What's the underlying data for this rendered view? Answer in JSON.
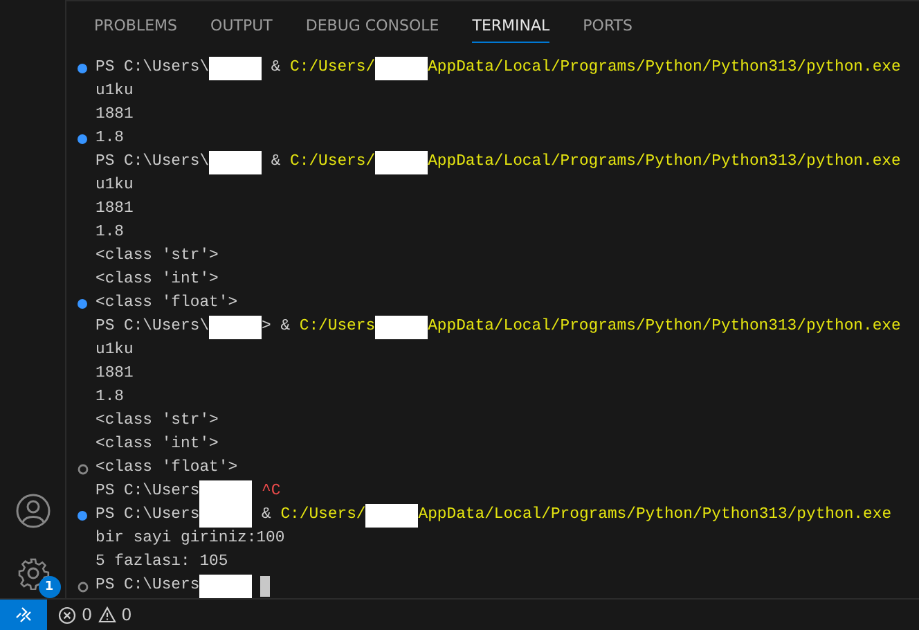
{
  "tabs": [
    {
      "label": "PROBLEMS",
      "selected": false
    },
    {
      "label": "OUTPUT",
      "selected": false
    },
    {
      "label": "DEBUG CONSOLE",
      "selected": false
    },
    {
      "label": "TERMINAL",
      "selected": true
    },
    {
      "label": "PORTS",
      "selected": false
    }
  ],
  "terminal": {
    "lines": [
      {
        "marker": true,
        "success": true,
        "segments": [
          {
            "kind": "text",
            "text": "PS C:\\Users\\"
          },
          {
            "kind": "redacted"
          },
          {
            "kind": "text",
            "text": " & "
          },
          {
            "kind": "path",
            "text": "C:/Users/"
          },
          {
            "kind": "redacted"
          },
          {
            "kind": "path",
            "text": "AppData/Local/Programs/Python/Python313/python.exe"
          }
        ]
      },
      {
        "marker": false,
        "segments": [
          {
            "kind": "text",
            "text": "u1ku"
          }
        ]
      },
      {
        "marker": false,
        "segments": [
          {
            "kind": "text",
            "text": "1881"
          }
        ]
      },
      {
        "marker": true,
        "success": true,
        "segments": [
          {
            "kind": "text",
            "text": "1.8"
          }
        ]
      },
      {
        "marker": false,
        "segments": [
          {
            "kind": "text",
            "text": "PS C:\\Users\\"
          },
          {
            "kind": "redacted"
          },
          {
            "kind": "text",
            "text": " & "
          },
          {
            "kind": "path",
            "text": "C:/Users/"
          },
          {
            "kind": "redacted"
          },
          {
            "kind": "path",
            "text": "AppData/Local/Programs/Python/Python313/python.exe"
          }
        ]
      },
      {
        "marker": false,
        "segments": [
          {
            "kind": "text",
            "text": "u1ku"
          }
        ]
      },
      {
        "marker": false,
        "segments": [
          {
            "kind": "text",
            "text": "1881"
          }
        ]
      },
      {
        "marker": false,
        "segments": [
          {
            "kind": "text",
            "text": "1.8"
          }
        ]
      },
      {
        "marker": false,
        "segments": [
          {
            "kind": "text",
            "text": "<class 'str'>"
          }
        ]
      },
      {
        "marker": false,
        "segments": [
          {
            "kind": "text",
            "text": "<class 'int'>"
          }
        ]
      },
      {
        "marker": true,
        "success": true,
        "segments": [
          {
            "kind": "text",
            "text": "<class 'float'>"
          }
        ]
      },
      {
        "marker": false,
        "segments": [
          {
            "kind": "text",
            "text": "PS C:\\Users\\"
          },
          {
            "kind": "redacted"
          },
          {
            "kind": "text",
            "text": "> & "
          },
          {
            "kind": "path",
            "text": "C:/Users"
          },
          {
            "kind": "redacted"
          },
          {
            "kind": "path",
            "text": "AppData/Local/Programs/Python/Python313/python.exe"
          }
        ]
      },
      {
        "marker": false,
        "segments": [
          {
            "kind": "text",
            "text": "u1ku"
          }
        ]
      },
      {
        "marker": false,
        "segments": [
          {
            "kind": "text",
            "text": "1881"
          }
        ]
      },
      {
        "marker": false,
        "segments": [
          {
            "kind": "text",
            "text": "1.8"
          }
        ]
      },
      {
        "marker": false,
        "segments": [
          {
            "kind": "text",
            "text": "<class 'str'>"
          }
        ]
      },
      {
        "marker": false,
        "segments": [
          {
            "kind": "text",
            "text": "<class 'int'>"
          }
        ]
      },
      {
        "marker": true,
        "success": false,
        "segments": [
          {
            "kind": "text",
            "text": "<class 'float'>"
          }
        ]
      },
      {
        "marker": false,
        "segments": [
          {
            "kind": "text",
            "text": "PS C:\\Users"
          },
          {
            "kind": "redacted"
          },
          {
            "kind": "error",
            "text": " ^C"
          }
        ]
      },
      {
        "marker": true,
        "success": true,
        "segments": [
          {
            "kind": "text",
            "text": "PS C:\\Users"
          },
          {
            "kind": "redacted"
          },
          {
            "kind": "text",
            "text": " & "
          },
          {
            "kind": "path",
            "text": "C:/Users/"
          },
          {
            "kind": "redacted"
          },
          {
            "kind": "path",
            "text": "AppData/Local/Programs/Python/Python313/python.exe"
          }
        ]
      },
      {
        "marker": false,
        "segments": [
          {
            "kind": "text",
            "text": "bir sayi giriniz:100"
          }
        ]
      },
      {
        "marker": false,
        "segments": [
          {
            "kind": "text",
            "text": "5 fazlası: 105"
          }
        ]
      },
      {
        "marker": true,
        "success": false,
        "segments": [
          {
            "kind": "text",
            "text": "PS C:\\Users"
          },
          {
            "kind": "redacted"
          },
          {
            "kind": "cursor"
          }
        ]
      }
    ]
  },
  "activity_bar": {
    "settings_badge": "1"
  },
  "status_bar": {
    "errors": "0",
    "warnings": "0"
  }
}
